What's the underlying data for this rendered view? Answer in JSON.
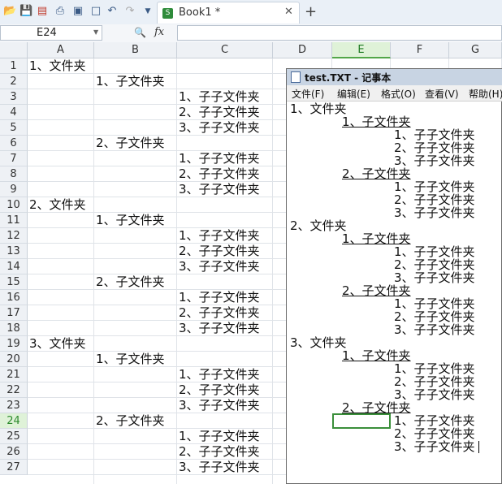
{
  "toolbar": {
    "icons": [
      "open-folder-icon",
      "save-icon",
      "export-pdf-icon",
      "print-icon",
      "print-preview-icon",
      "preview-icon",
      "undo-icon",
      "redo-icon",
      "dropdown-icon"
    ]
  },
  "tab": {
    "label": "Book1 *",
    "close": "✕",
    "add": "+"
  },
  "formula_bar": {
    "name_box": "E24",
    "fx": "fx",
    "formula": ""
  },
  "columns": [
    "A",
    "B",
    "C",
    "D",
    "E",
    "F",
    "G"
  ],
  "selected_column": "E",
  "rows": [
    "1",
    "2",
    "3",
    "4",
    "5",
    "6",
    "7",
    "8",
    "9",
    "10",
    "11",
    "12",
    "13",
    "14",
    "15",
    "16",
    "17",
    "18",
    "19",
    "20",
    "21",
    "22",
    "23",
    "24",
    "25",
    "26",
    "27"
  ],
  "selected_row": "24",
  "cells": [
    {
      "row": 1,
      "col": "A",
      "text": "1、文件夹"
    },
    {
      "row": 2,
      "col": "B",
      "text": "1、子文件夹"
    },
    {
      "row": 3,
      "col": "C",
      "text": "1、子子文件夹"
    },
    {
      "row": 4,
      "col": "C",
      "text": "2、子子文件夹"
    },
    {
      "row": 5,
      "col": "C",
      "text": "3、子子文件夹"
    },
    {
      "row": 6,
      "col": "B",
      "text": "2、子文件夹"
    },
    {
      "row": 7,
      "col": "C",
      "text": "1、子子文件夹"
    },
    {
      "row": 8,
      "col": "C",
      "text": "2、子子文件夹"
    },
    {
      "row": 9,
      "col": "C",
      "text": "3、子子文件夹"
    },
    {
      "row": 10,
      "col": "A",
      "text": "2、文件夹"
    },
    {
      "row": 11,
      "col": "B",
      "text": "1、子文件夹"
    },
    {
      "row": 12,
      "col": "C",
      "text": "1、子子文件夹"
    },
    {
      "row": 13,
      "col": "C",
      "text": "2、子子文件夹"
    },
    {
      "row": 14,
      "col": "C",
      "text": "3、子子文件夹"
    },
    {
      "row": 15,
      "col": "B",
      "text": "2、子文件夹"
    },
    {
      "row": 16,
      "col": "C",
      "text": "1、子子文件夹"
    },
    {
      "row": 17,
      "col": "C",
      "text": "2、子子文件夹"
    },
    {
      "row": 18,
      "col": "C",
      "text": "3、子子文件夹"
    },
    {
      "row": 19,
      "col": "A",
      "text": "3、文件夹"
    },
    {
      "row": 20,
      "col": "B",
      "text": "1、子文件夹"
    },
    {
      "row": 21,
      "col": "C",
      "text": "1、子子文件夹"
    },
    {
      "row": 22,
      "col": "C",
      "text": "2、子子文件夹"
    },
    {
      "row": 23,
      "col": "C",
      "text": "3、子子文件夹"
    },
    {
      "row": 24,
      "col": "B",
      "text": "2、子文件夹"
    },
    {
      "row": 25,
      "col": "C",
      "text": "1、子子文件夹"
    },
    {
      "row": 26,
      "col": "C",
      "text": "2、子子文件夹"
    },
    {
      "row": 27,
      "col": "C",
      "text": "3、子子文件夹"
    }
  ],
  "notepad": {
    "title": "test.TXT - 记事本",
    "menu": [
      "文件(F)",
      "编辑(E)",
      "格式(O)",
      "查看(V)",
      "帮助(H)"
    ],
    "lines": [
      {
        "level": 0,
        "text": "1、文件夹"
      },
      {
        "level": 1,
        "text": "1、子文件夹"
      },
      {
        "level": 2,
        "text": "1、子子文件夹"
      },
      {
        "level": 2,
        "text": "2、子子文件夹"
      },
      {
        "level": 2,
        "text": "3、子子文件夹"
      },
      {
        "level": 1,
        "text": "2、子文件夹"
      },
      {
        "level": 2,
        "text": "1、子子文件夹"
      },
      {
        "level": 2,
        "text": "2、子子文件夹"
      },
      {
        "level": 2,
        "text": "3、子子文件夹"
      },
      {
        "level": 0,
        "text": "2、文件夹"
      },
      {
        "level": 1,
        "text": "1、子文件夹"
      },
      {
        "level": 2,
        "text": "1、子子文件夹"
      },
      {
        "level": 2,
        "text": "2、子子文件夹"
      },
      {
        "level": 2,
        "text": "3、子子文件夹"
      },
      {
        "level": 1,
        "text": "2、子文件夹"
      },
      {
        "level": 2,
        "text": "1、子子文件夹"
      },
      {
        "level": 2,
        "text": "2、子子文件夹"
      },
      {
        "level": 2,
        "text": "3、子子文件夹"
      },
      {
        "level": 0,
        "text": "3、文件夹"
      },
      {
        "level": 1,
        "text": "1、子文件夹"
      },
      {
        "level": 2,
        "text": "1、子子文件夹"
      },
      {
        "level": 2,
        "text": "2、子子文件夹"
      },
      {
        "level": 2,
        "text": "3、子子文件夹"
      },
      {
        "level": 1,
        "text": "2、子文件夹"
      },
      {
        "level": 2,
        "text": "1、子子文件夹"
      },
      {
        "level": 2,
        "text": "2、子子文件夹"
      },
      {
        "level": 2,
        "text": "3、子子文件夹"
      }
    ]
  },
  "colors": {
    "selection": "#3a8f3a",
    "header_bg": "#eef1f5",
    "accent": "#2e8b3a"
  }
}
